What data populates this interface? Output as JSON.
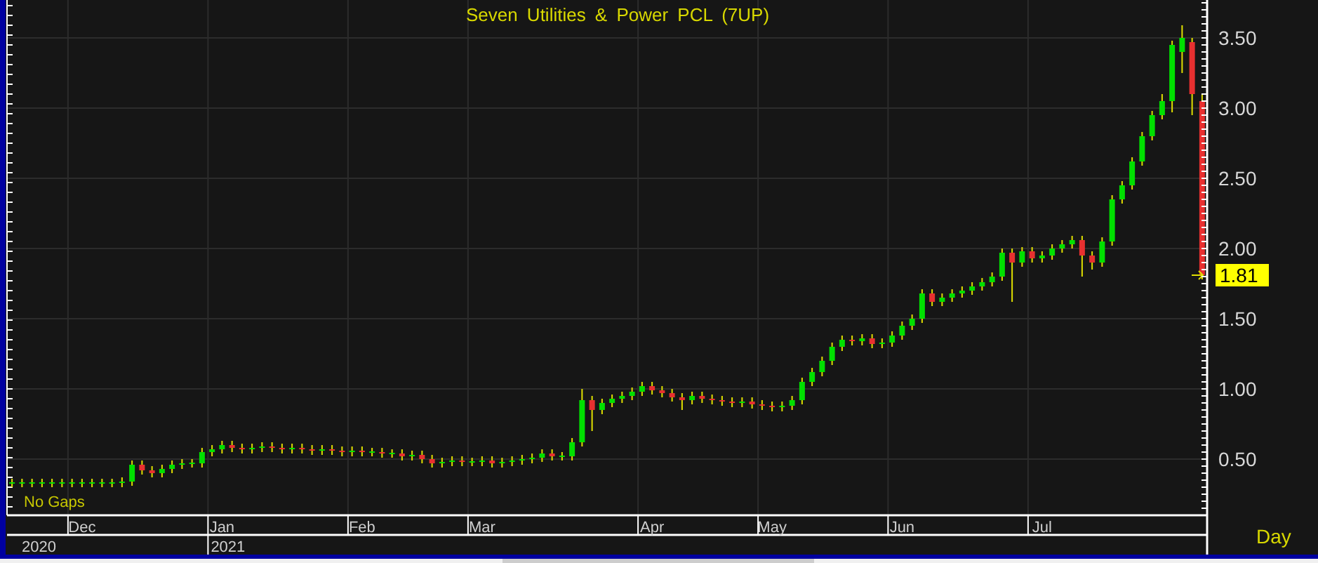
{
  "chart": {
    "title": "Seven Utilities & Power PCL (7UP)",
    "note": "No Gaps",
    "last_price": "1.81",
    "interval": "Day",
    "years": [
      "2020",
      "2021"
    ],
    "chart_data": {
      "type": "candlestick",
      "grid": true,
      "ylim": [
        0.1,
        3.77
      ],
      "yticks": [
        {
          "value": 0.5,
          "label": "0.50"
        },
        {
          "value": 1,
          "label": "1.00"
        },
        {
          "value": 1.5,
          "label": "1.50"
        },
        {
          "value": 2,
          "label": "2.00"
        },
        {
          "value": 2.5,
          "label": "2.50"
        },
        {
          "value": 3,
          "label": "3.00"
        },
        {
          "value": 3.5,
          "label": "3.50"
        }
      ],
      "categories": [
        null,
        null,
        null,
        null,
        null,
        null,
        null,
        "Dec",
        null,
        null,
        null,
        null,
        null,
        null,
        null,
        null,
        null,
        null,
        null,
        null,
        null,
        "Jan",
        null,
        null,
        null,
        null,
        null,
        null,
        null,
        null,
        null,
        null,
        null,
        null,
        null,
        "Feb",
        null,
        null,
        null,
        null,
        null,
        null,
        null,
        null,
        null,
        null,
        null,
        "Mar",
        null,
        null,
        null,
        null,
        null,
        null,
        null,
        null,
        null,
        null,
        null,
        null,
        null,
        null,
        null,
        null,
        "Apr",
        null,
        null,
        null,
        null,
        null,
        null,
        null,
        null,
        null,
        null,
        null,
        "May",
        null,
        null,
        null,
        null,
        null,
        null,
        null,
        null,
        null,
        null,
        null,
        null,
        "Jun",
        null,
        null,
        null,
        null,
        null,
        null,
        null,
        null,
        null,
        null,
        null,
        null,
        null,
        "Jul",
        null,
        null,
        null,
        null,
        null,
        null,
        null,
        null,
        null,
        null,
        null,
        null,
        null,
        null,
        null,
        null
      ],
      "ohlc": [
        [
          0.33,
          0.36,
          0.3,
          0.33
        ],
        [
          0.33,
          0.36,
          0.3,
          0.33
        ],
        [
          0.33,
          0.36,
          0.3,
          0.33
        ],
        [
          0.33,
          0.36,
          0.3,
          0.33
        ],
        [
          0.33,
          0.36,
          0.3,
          0.33
        ],
        [
          0.33,
          0.36,
          0.3,
          0.33
        ],
        [
          0.33,
          0.36,
          0.3,
          0.33
        ],
        [
          0.33,
          0.36,
          0.3,
          0.33
        ],
        [
          0.33,
          0.36,
          0.3,
          0.33
        ],
        [
          0.33,
          0.36,
          0.3,
          0.33
        ],
        [
          0.33,
          0.36,
          0.3,
          0.33
        ],
        [
          0.33,
          0.37,
          0.3,
          0.34
        ],
        [
          0.34,
          0.49,
          0.31,
          0.46
        ],
        [
          0.46,
          0.49,
          0.39,
          0.42
        ],
        [
          0.42,
          0.45,
          0.37,
          0.4
        ],
        [
          0.4,
          0.46,
          0.37,
          0.43
        ],
        [
          0.43,
          0.49,
          0.4,
          0.46
        ],
        [
          0.46,
          0.5,
          0.43,
          0.47
        ],
        [
          0.47,
          0.5,
          0.44,
          0.47
        ],
        [
          0.47,
          0.58,
          0.44,
          0.55
        ],
        [
          0.55,
          0.6,
          0.52,
          0.57
        ],
        [
          0.57,
          0.63,
          0.54,
          0.6
        ],
        [
          0.6,
          0.63,
          0.55,
          0.58
        ],
        [
          0.58,
          0.61,
          0.54,
          0.57
        ],
        [
          0.57,
          0.61,
          0.54,
          0.58
        ],
        [
          0.58,
          0.62,
          0.55,
          0.59
        ],
        [
          0.59,
          0.62,
          0.55,
          0.58
        ],
        [
          0.58,
          0.61,
          0.54,
          0.57
        ],
        [
          0.57,
          0.61,
          0.54,
          0.58
        ],
        [
          0.58,
          0.61,
          0.54,
          0.57
        ],
        [
          0.57,
          0.6,
          0.53,
          0.56
        ],
        [
          0.56,
          0.6,
          0.53,
          0.57
        ],
        [
          0.57,
          0.6,
          0.53,
          0.56
        ],
        [
          0.56,
          0.59,
          0.52,
          0.55
        ],
        [
          0.55,
          0.59,
          0.52,
          0.56
        ],
        [
          0.56,
          0.59,
          0.52,
          0.55
        ],
        [
          0.55,
          0.58,
          0.52,
          0.55
        ],
        [
          0.55,
          0.58,
          0.51,
          0.54
        ],
        [
          0.54,
          0.57,
          0.51,
          0.54
        ],
        [
          0.54,
          0.57,
          0.49,
          0.52
        ],
        [
          0.52,
          0.56,
          0.49,
          0.53
        ],
        [
          0.53,
          0.56,
          0.47,
          0.5
        ],
        [
          0.5,
          0.53,
          0.44,
          0.47
        ],
        [
          0.47,
          0.51,
          0.44,
          0.48
        ],
        [
          0.48,
          0.52,
          0.45,
          0.49
        ],
        [
          0.49,
          0.52,
          0.45,
          0.48
        ],
        [
          0.48,
          0.51,
          0.45,
          0.48
        ],
        [
          0.48,
          0.52,
          0.45,
          0.49
        ],
        [
          0.49,
          0.52,
          0.44,
          0.47
        ],
        [
          0.47,
          0.51,
          0.44,
          0.48
        ],
        [
          0.48,
          0.52,
          0.45,
          0.49
        ],
        [
          0.49,
          0.53,
          0.46,
          0.5
        ],
        [
          0.5,
          0.54,
          0.47,
          0.51
        ],
        [
          0.51,
          0.57,
          0.48,
          0.54
        ],
        [
          0.54,
          0.57,
          0.49,
          0.52
        ],
        [
          0.52,
          0.55,
          0.49,
          0.52
        ],
        [
          0.52,
          0.65,
          0.49,
          0.62
        ],
        [
          0.62,
          1.0,
          0.59,
          0.92
        ],
        [
          0.92,
          0.95,
          0.7,
          0.85
        ],
        [
          0.85,
          0.93,
          0.82,
          0.9
        ],
        [
          0.9,
          0.96,
          0.87,
          0.93
        ],
        [
          0.93,
          0.98,
          0.9,
          0.95
        ],
        [
          0.95,
          1.01,
          0.92,
          0.98
        ],
        [
          0.98,
          1.05,
          0.95,
          1.02
        ],
        [
          1.02,
          1.05,
          0.96,
          0.99
        ],
        [
          0.99,
          1.02,
          0.94,
          0.97
        ],
        [
          0.97,
          1.0,
          0.91,
          0.94
        ],
        [
          0.94,
          0.97,
          0.85,
          0.92
        ],
        [
          0.92,
          0.98,
          0.89,
          0.95
        ],
        [
          0.95,
          0.98,
          0.9,
          0.93
        ],
        [
          0.93,
          0.96,
          0.89,
          0.92
        ],
        [
          0.92,
          0.95,
          0.88,
          0.91
        ],
        [
          0.91,
          0.94,
          0.87,
          0.9
        ],
        [
          0.9,
          0.94,
          0.87,
          0.91
        ],
        [
          0.91,
          0.94,
          0.86,
          0.89
        ],
        [
          0.89,
          0.92,
          0.85,
          0.88
        ],
        [
          0.88,
          0.91,
          0.84,
          0.87
        ],
        [
          0.87,
          0.91,
          0.84,
          0.88
        ],
        [
          0.88,
          0.95,
          0.85,
          0.92
        ],
        [
          0.92,
          1.08,
          0.89,
          1.05
        ],
        [
          1.05,
          1.15,
          1.02,
          1.12
        ],
        [
          1.12,
          1.23,
          1.09,
          1.2
        ],
        [
          1.2,
          1.33,
          1.17,
          1.3
        ],
        [
          1.3,
          1.38,
          1.27,
          1.35
        ],
        [
          1.35,
          1.38,
          1.31,
          1.34
        ],
        [
          1.34,
          1.39,
          1.31,
          1.36
        ],
        [
          1.36,
          1.39,
          1.29,
          1.32
        ],
        [
          1.32,
          1.36,
          1.29,
          1.33
        ],
        [
          1.33,
          1.41,
          1.3,
          1.38
        ],
        [
          1.38,
          1.48,
          1.35,
          1.45
        ],
        [
          1.45,
          1.53,
          1.42,
          1.5
        ],
        [
          1.5,
          1.71,
          1.47,
          1.68
        ],
        [
          1.68,
          1.71,
          1.59,
          1.62
        ],
        [
          1.62,
          1.68,
          1.59,
          1.65
        ],
        [
          1.65,
          1.71,
          1.62,
          1.68
        ],
        [
          1.68,
          1.73,
          1.65,
          1.7
        ],
        [
          1.7,
          1.76,
          1.67,
          1.73
        ],
        [
          1.73,
          1.79,
          1.7,
          1.76
        ],
        [
          1.76,
          1.83,
          1.73,
          1.8
        ],
        [
          1.8,
          2.0,
          1.77,
          1.97
        ],
        [
          1.97,
          2.0,
          1.62,
          1.9
        ],
        [
          1.9,
          2.01,
          1.87,
          1.98
        ],
        [
          1.98,
          2.01,
          1.9,
          1.93
        ],
        [
          1.93,
          1.98,
          1.9,
          1.95
        ],
        [
          1.95,
          2.03,
          1.92,
          2.0
        ],
        [
          2.0,
          2.06,
          1.97,
          2.03
        ],
        [
          2.03,
          2.09,
          2.0,
          2.06
        ],
        [
          2.06,
          2.09,
          1.8,
          1.95
        ],
        [
          1.95,
          1.98,
          1.85,
          1.9
        ],
        [
          1.9,
          2.08,
          1.87,
          2.05
        ],
        [
          2.05,
          2.38,
          2.02,
          2.35
        ],
        [
          2.35,
          2.48,
          2.32,
          2.45
        ],
        [
          2.45,
          2.65,
          2.42,
          2.62
        ],
        [
          2.62,
          2.83,
          2.59,
          2.8
        ],
        [
          2.8,
          2.98,
          2.77,
          2.95
        ],
        [
          2.95,
          3.1,
          2.92,
          3.05
        ],
        [
          3.05,
          3.48,
          2.97,
          3.45
        ],
        [
          3.4,
          3.59,
          3.25,
          3.5
        ],
        [
          3.47,
          3.5,
          2.95,
          3.1
        ],
        [
          3.05,
          3.1,
          1.78,
          1.81
        ]
      ]
    }
  }
}
